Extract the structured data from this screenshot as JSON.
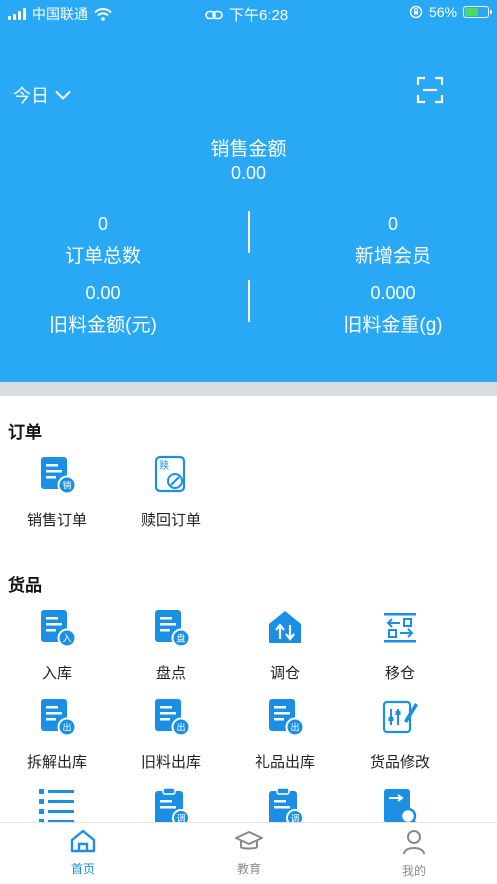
{
  "status_bar": {
    "carrier": "中国联通",
    "time": "下午6:28",
    "battery": "56%"
  },
  "header": {
    "date_filter": "今日"
  },
  "summary": {
    "sales_amount_label": "销售金额",
    "sales_amount_value": "0.00",
    "stats": [
      {
        "label": "订单总数",
        "value": "0"
      },
      {
        "label": "新增会员",
        "value": "0"
      },
      {
        "label": "旧料金额(元)",
        "value": "0.00"
      },
      {
        "label": "旧料金重(g)",
        "value": "0.000"
      }
    ]
  },
  "sections": {
    "orders": {
      "title": "订单",
      "items": [
        "销售订单",
        "赎回订单"
      ]
    },
    "goods": {
      "title": "货品",
      "items": [
        "入库",
        "盘点",
        "调仓",
        "移仓",
        "拆解出库",
        "旧料出库",
        "礼品出库",
        "货品修改"
      ]
    }
  },
  "tabs": [
    {
      "label": "首页",
      "icon": "home-icon",
      "active": true
    },
    {
      "label": "教育",
      "icon": "graduation-cap-icon",
      "active": false
    },
    {
      "label": "我的",
      "icon": "person-icon",
      "active": false
    }
  ],
  "colors": {
    "primary": "#29a8f5",
    "icon_blue": "#1a8fe3",
    "tab_active": "#1a8fe3",
    "tab_inactive": "#8a8a8a"
  }
}
